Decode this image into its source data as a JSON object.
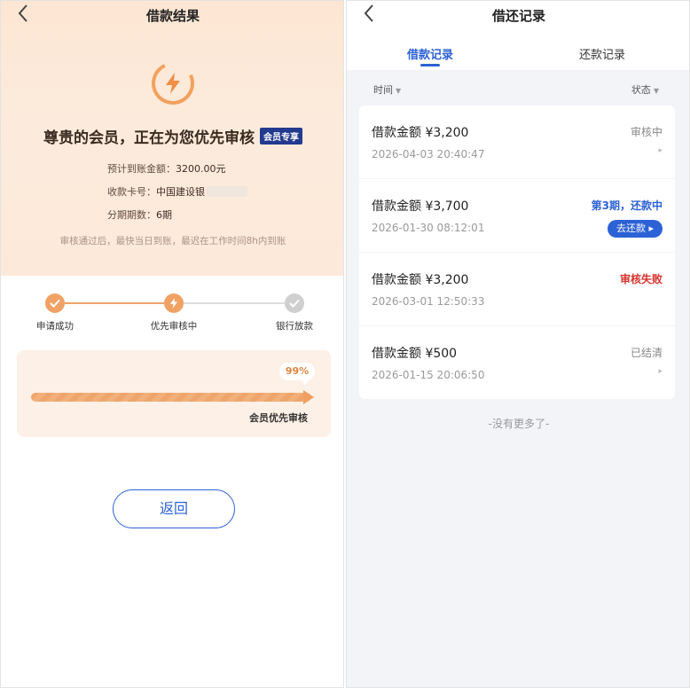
{
  "left": {
    "nav": {
      "back_icon": "chevron-left-icon",
      "title": "借款结果"
    },
    "hero": {
      "icon": "lightning-icon",
      "title": "尊贵的会员，正在为您优先审核",
      "badge": "会员专享",
      "expected_amount_label": "预计到账金额：",
      "expected_amount_value": "3200.00元",
      "card_label": "收款卡号：",
      "card_value": "中国建设银",
      "periods_label": "分期期数：",
      "periods_value": "6期",
      "note": "审核通过后，最快当日到账，最迟在工作时间8h内到账"
    },
    "steps": [
      {
        "label": "申请成功",
        "state": "done",
        "icon": "check-icon"
      },
      {
        "label": "优先审核中",
        "state": "active",
        "icon": "lightning-icon"
      },
      {
        "label": "银行放款",
        "state": "pending",
        "icon": "check-icon"
      }
    ],
    "progress": {
      "percent_text": "99%",
      "fraction": 0.99,
      "caption": "会员优先审核"
    },
    "return_button": "返回",
    "colors": {
      "accent_orange": "#ef9f61",
      "brand_blue": "#2d62d6"
    }
  },
  "right": {
    "nav": {
      "back_icon": "chevron-left-icon",
      "title": "借还记录"
    },
    "tabs": [
      {
        "label": "借款记录",
        "active": true
      },
      {
        "label": "还款记录",
        "active": false
      }
    ],
    "filters": {
      "time": "时间",
      "status": "状态"
    },
    "records": [
      {
        "amount": "借款金额 ¥3,200",
        "time": "2026-04-03 20:40:47",
        "status": "审核中",
        "tone": "gray",
        "action": ""
      },
      {
        "amount": "借款金额 ¥3,700",
        "time": "2026-01-30 08:12:01",
        "status": "第3期，还款中",
        "tone": "blue",
        "action": "去还款 ▸"
      },
      {
        "amount": "借款金额 ¥3,200",
        "time": "2026-03-01 12:50:33",
        "status": "审核失败",
        "tone": "red",
        "action": ""
      },
      {
        "amount": "借款金额 ¥500",
        "time": "2026-01-15 20:06:50",
        "status": "已结清",
        "tone": "gray",
        "action": ""
      }
    ],
    "no_more": "-没有更多了-",
    "colors": {
      "status_blue": "#2d62d6",
      "status_red": "#d6332d"
    }
  }
}
